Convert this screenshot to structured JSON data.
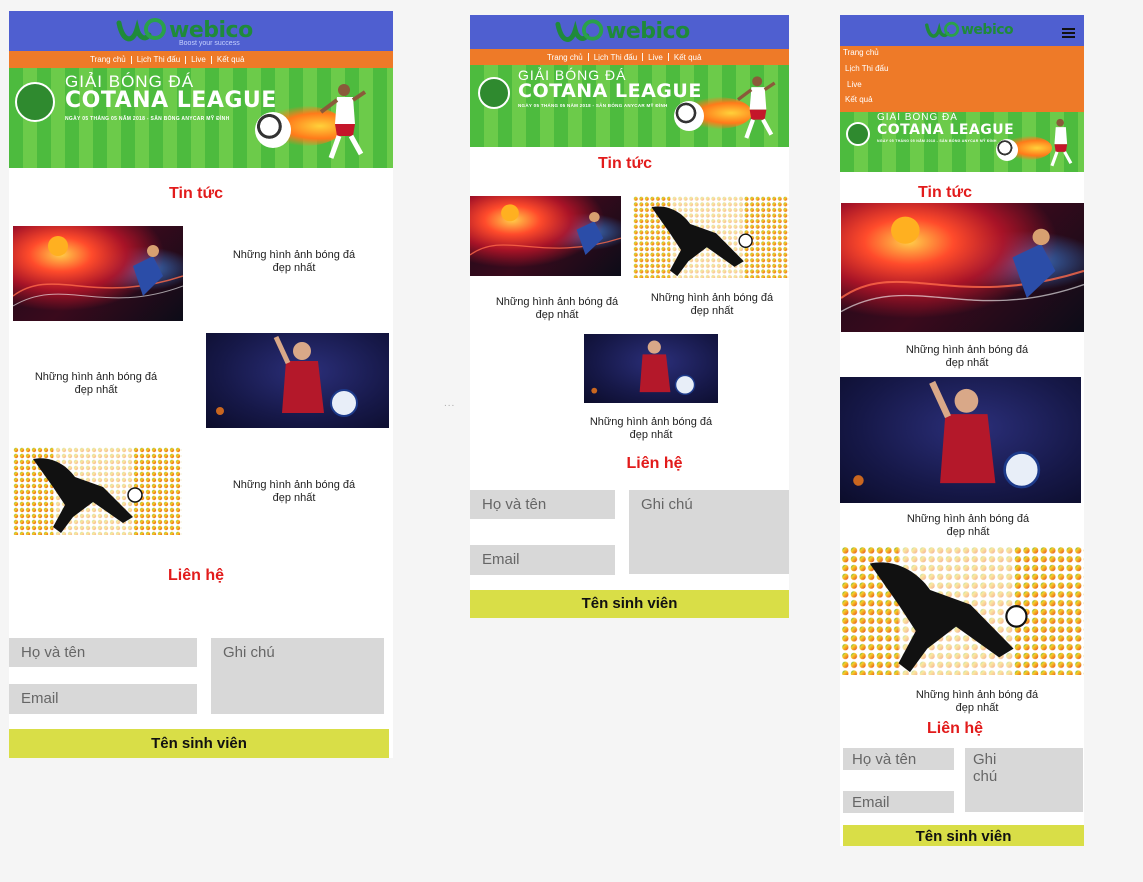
{
  "brand": {
    "name": "webico",
    "tagline": "Boost your success",
    "colors": {
      "header": "#4f5fd0",
      "nav": "#ee7a28",
      "title": "#e21b1b",
      "submit": "#d9de47",
      "field": "#d8d8d8"
    }
  },
  "nav": {
    "items": [
      "Trang chủ",
      "Lịch Thi đấu",
      "Live",
      "Kết quả"
    ]
  },
  "banner": {
    "line1": "GIẢI BÓNG ĐÁ",
    "line2": "COTANA LEAGUE",
    "line3": "NGÀY 05 THÁNG 05 NĂM 2018 - SÂN BÓNG ANYCAR MỸ ĐÌNH"
  },
  "news": {
    "title": "Tin tức",
    "caption": "Những hình ảnh bóng đá đẹp nhất"
  },
  "contact": {
    "title": "Liên hệ",
    "name_placeholder": "Họ và tên",
    "email_placeholder": "Email",
    "note_placeholder": "Ghi chú",
    "submit_label": "Tên sinh viên"
  },
  "misc": {
    "separator": "..."
  }
}
